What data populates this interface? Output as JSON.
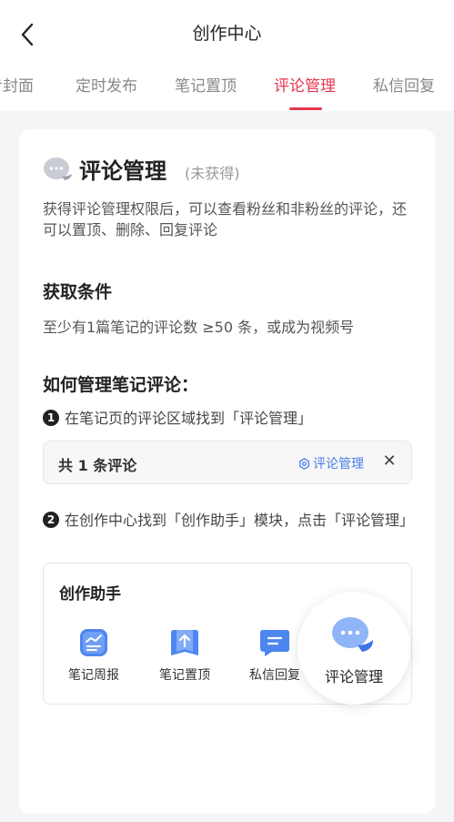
{
  "header": {
    "title": "创作中心"
  },
  "tabs": [
    {
      "label": "专封面"
    },
    {
      "label": "定时发布"
    },
    {
      "label": "笔记置顶"
    },
    {
      "label": "评论管理"
    },
    {
      "label": "私信回复"
    }
  ],
  "active_tab_index": 3,
  "card": {
    "title": "评论管理",
    "badge": "(未获得)",
    "description": "获得评论管理权限后，可以查看粉丝和非粉丝的评论，还可以置顶、删除、回复评论",
    "conditions_title": "获取条件",
    "conditions_text": "至少有1篇笔记的评论数 ≥50 条，或成为视频号",
    "howto_title": "如何管理笔记评论：",
    "step1_num": "1",
    "step1_text": "在笔记页的评论区域找到「评论管理」",
    "comment_bar": {
      "count": "共 1 条评论",
      "manage": "评论管理",
      "close": "✕"
    },
    "step2_num": "2",
    "step2_text": "在创作中心找到「创作助手」模块，点击「评论管理」",
    "assistant": {
      "title": "创作助手",
      "items": [
        {
          "label": "笔记周报",
          "icon": "weekly-report-icon"
        },
        {
          "label": "笔记置顶",
          "icon": "pin-note-icon"
        },
        {
          "label": "私信回复",
          "icon": "message-reply-icon"
        }
      ],
      "highlight": {
        "label": "评论管理",
        "icon": "comment-manage-icon"
      }
    }
  },
  "colors": {
    "accent": "#e8344e",
    "link": "#4a7ee8",
    "icon_blue": "#4e86f0"
  }
}
